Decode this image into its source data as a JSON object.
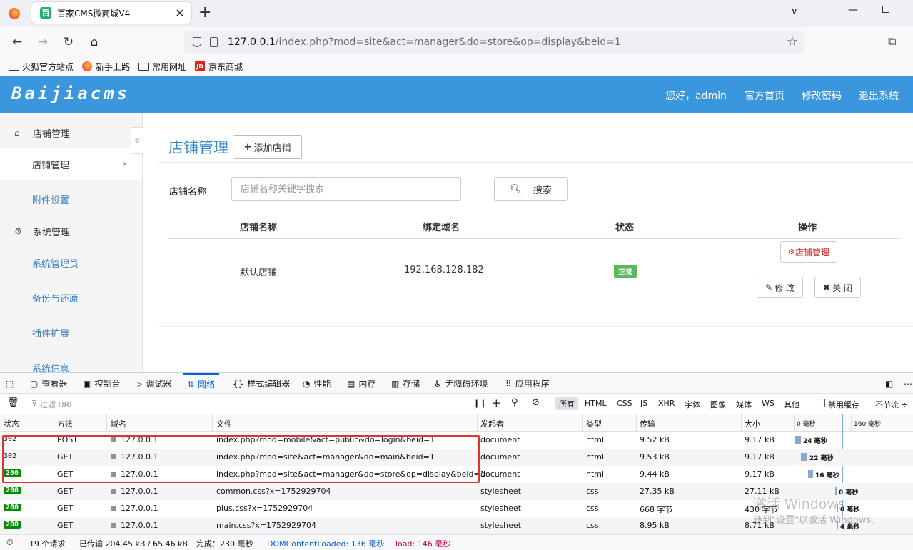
{
  "browser": {
    "tab_title": "百家CMS微商城V4",
    "tab_icon": "百",
    "url_host": "127.0.0.1",
    "url_path": "/index.php?mod=site&act=manager&do=store&op=display&beid=1",
    "bookmarks": [
      "火狐官方站点",
      "新手上路",
      "常用网址",
      "京东商城"
    ],
    "bookmark_jd_icon": "JD"
  },
  "site": {
    "logo": "Baijiacms",
    "greeting": "您好，admin",
    "nav": [
      "官方首页",
      "修改密码",
      "退出系统"
    ],
    "accent_color": "#3a97dd"
  },
  "sidebar": {
    "group1": "店铺管理",
    "items1": [
      "店铺管理",
      "附件设置"
    ],
    "group2": "系统管理",
    "items2": [
      "系统管理员",
      "备份与还原",
      "插件扩展",
      "系统信息"
    ],
    "collapse": "«"
  },
  "main": {
    "title": "店铺管理",
    "add_button": "添加店铺",
    "search_label": "店铺名称",
    "search_placeholder": "店铺名称关键字搜索",
    "search_button": "搜索",
    "columns": [
      "店铺名称",
      "绑定域名",
      "状态",
      "操作"
    ],
    "row": {
      "name": "默认店铺",
      "domain": "192.168.128.182",
      "status": "正常",
      "manage": "店铺管理",
      "edit": "修 改",
      "close": "关 闭"
    }
  },
  "devtools": {
    "tabs": [
      "查看器",
      "控制台",
      "调试器",
      "网络",
      "样式编辑器",
      "性能",
      "内存",
      "存储",
      "无障碍环境",
      "应用程序"
    ],
    "filter_placeholder": "过滤 URL",
    "filter_types": [
      "所有",
      "HTML",
      "CSS",
      "JS",
      "XHR",
      "字体",
      "图像",
      "媒体",
      "WS",
      "其他"
    ],
    "disable_cache": "禁用缓存",
    "throttle": "不节流 ÷",
    "headers": [
      "状态",
      "方法",
      "域名",
      "文件",
      "发起者",
      "类型",
      "传输",
      "大小"
    ],
    "waterfall_ticks": [
      "0 毫秒",
      "160 毫秒"
    ],
    "requests": [
      {
        "status": "302",
        "method": "POST",
        "domain": "127.0.0.1",
        "file": "index.php?mod=mobile&act=public&do=login&beid=1",
        "initiator": "document",
        "type": "html",
        "transfer": "9.52 kB",
        "size": "9.17 kB",
        "time": "24 毫秒"
      },
      {
        "status": "302",
        "method": "GET",
        "domain": "127.0.0.1",
        "file": "index.php?mod=site&act=manager&do=main&beid=1",
        "initiator": "document",
        "type": "html",
        "transfer": "9.53 kB",
        "size": "9.17 kB",
        "time": "22 毫秒"
      },
      {
        "status": "200",
        "method": "GET",
        "domain": "127.0.0.1",
        "file": "index.php?mod=site&act=manager&do=store&op=display&beid=1",
        "initiator": "document",
        "type": "html",
        "transfer": "9.44 kB",
        "size": "9.17 kB",
        "time": "16 毫秒"
      },
      {
        "status": "200",
        "method": "GET",
        "domain": "127.0.0.1",
        "file": "common.css?x=1752929704",
        "initiator": "stylesheet",
        "type": "css",
        "transfer": "27.35 kB",
        "size": "27.11 kB",
        "time": "0 毫秒"
      },
      {
        "status": "200",
        "method": "GET",
        "domain": "127.0.0.1",
        "file": "plus.css?x=1752929704",
        "initiator": "stylesheet",
        "type": "css",
        "transfer": "668 字节",
        "size": "430 字节",
        "time": "0 毫秒"
      },
      {
        "status": "200",
        "method": "GET",
        "domain": "127.0.0.1",
        "file": "main.css?x=1752929704",
        "initiator": "stylesheet",
        "type": "css",
        "transfer": "8.95 kB",
        "size": "8.71 kB",
        "time": "4 毫秒"
      }
    ],
    "summary": {
      "requests": "19 个请求",
      "transferred": "已传输 204.45 kB / 65.46 kB",
      "finish": "完成：230 毫秒",
      "dcl": "DOMContentLoaded: 136 毫秒",
      "load": "load: 146 毫秒"
    }
  },
  "watermark": {
    "line1": "激活 Windows",
    "line2": "转到\"设置\"以激活 Windows。"
  }
}
